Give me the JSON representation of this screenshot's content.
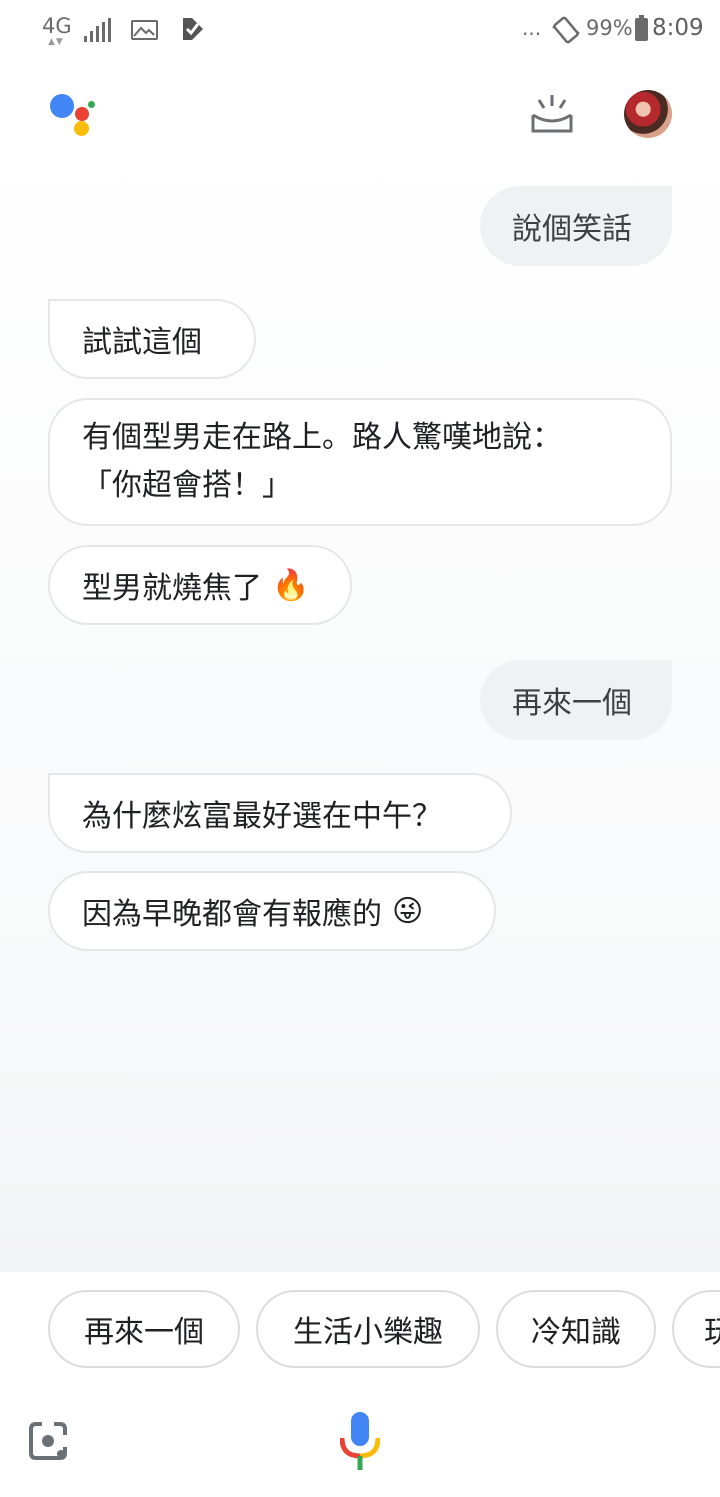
{
  "status_bar": {
    "network": "4G",
    "network_arrows": "▲▼",
    "more": "...",
    "battery_percent": "99%",
    "time": "8:09"
  },
  "header": {
    "logo_icon": "google-assistant-logo",
    "snapshot_icon": "snapshot-icon",
    "avatar_icon": "user-avatar"
  },
  "conversation": {
    "user_1": "說個笑話",
    "assistant_1": "試試這個",
    "assistant_2_line1": "有個型男走在路上。路人驚嘆地說：",
    "assistant_2_line2": "「你超會搭！」",
    "assistant_3": "型男就燒焦了",
    "assistant_3_emoji": "🔥",
    "user_2": "再來一個",
    "assistant_4": "為什麼炫富最好選在中午？",
    "assistant_5": "因為早晚都會有報應的",
    "assistant_5_emoji": "😜"
  },
  "suggestions": [
    {
      "label": "再來一個"
    },
    {
      "label": "生活小樂趣"
    },
    {
      "label": "冷知識"
    },
    {
      "label": "玩"
    }
  ],
  "bottom_bar": {
    "lens_icon": "google-lens-icon",
    "mic_icon": "microphone-icon"
  },
  "colors": {
    "user_bubble": "#f0f1f3",
    "assistant_border": "#e4e6e8",
    "google_blue": "#4285f4",
    "google_red": "#ea4335",
    "google_yellow": "#fbbc05",
    "google_green": "#34a853"
  }
}
